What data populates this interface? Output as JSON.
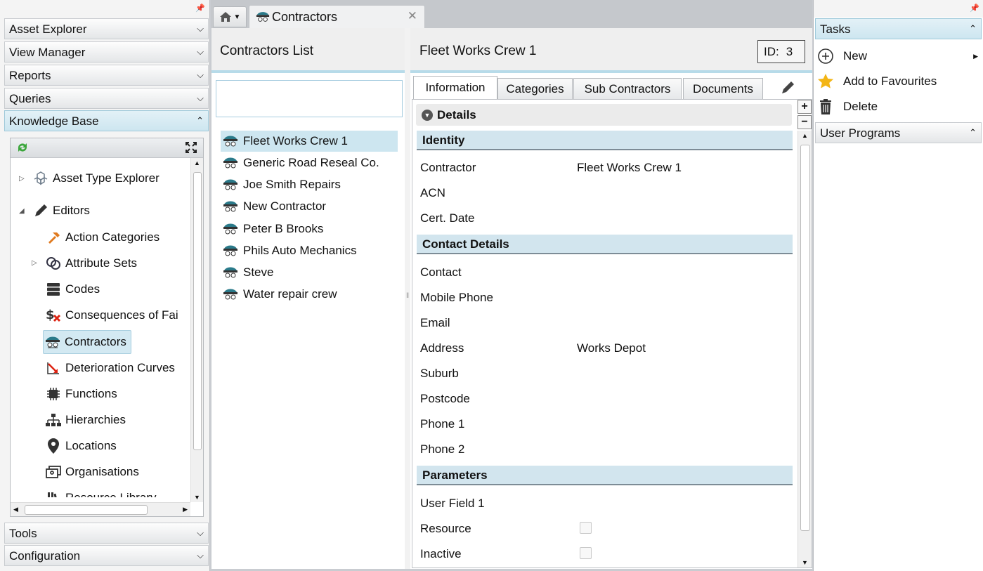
{
  "left_panel": {
    "sections_top": [
      {
        "label": "Asset Explorer",
        "expanded": false
      },
      {
        "label": "View Manager",
        "expanded": false
      },
      {
        "label": "Reports",
        "expanded": false
      },
      {
        "label": "Queries",
        "expanded": false
      },
      {
        "label": "Knowledge Base",
        "expanded": true
      }
    ],
    "tree": [
      {
        "label": "Asset Type Explorer",
        "icon": "cubes-icon",
        "level": 0,
        "expandable": true
      },
      {
        "label": "Editors",
        "icon": "pencil-icon",
        "level": 0,
        "expanded": true
      },
      {
        "label": "Action Categories",
        "icon": "hammer-icon",
        "level": 1
      },
      {
        "label": "Attribute Sets",
        "icon": "rings-icon",
        "level": 1,
        "expandable": true
      },
      {
        "label": "Codes",
        "icon": "database-icon",
        "level": 1
      },
      {
        "label": "Consequences of Fai",
        "icon": "dollar-cross-icon",
        "level": 1
      },
      {
        "label": "Contractors",
        "icon": "contractor-icon",
        "level": 1,
        "selected": true
      },
      {
        "label": "Deterioration Curves",
        "icon": "curve-icon",
        "level": 1
      },
      {
        "label": "Functions",
        "icon": "chip-icon",
        "level": 1
      },
      {
        "label": "Hierarchies",
        "icon": "hierarchy-icon",
        "level": 1
      },
      {
        "label": "Locations",
        "icon": "location-pin-icon",
        "level": 1
      },
      {
        "label": "Organisations",
        "icon": "organisation-icon",
        "level": 1
      },
      {
        "label": "Resource Library",
        "icon": "library-icon",
        "level": 1
      }
    ],
    "sections_bottom": [
      {
        "label": "Tools",
        "expanded": false
      },
      {
        "label": "Configuration",
        "expanded": false
      }
    ]
  },
  "tabs": {
    "home_label": "",
    "document_tab": "Contractors"
  },
  "list_panel": {
    "title": "Contractors List",
    "search_value": "",
    "items": [
      "Fleet Works Crew 1",
      "Generic Road Reseal Co.",
      "Joe Smith Repairs",
      "New Contractor",
      "Peter B Brooks",
      "Phils Auto Mechanics",
      "Steve",
      "Water repair crew"
    ],
    "selected_index": 0
  },
  "detail_panel": {
    "title": "Fleet Works Crew 1",
    "id_label": "ID:",
    "id_value": "3",
    "tabs": [
      "Information",
      "Categories",
      "Sub Contractors",
      "Documents"
    ],
    "active_tab": "Information",
    "details_label": "Details",
    "sections": {
      "identity": {
        "title": "Identity",
        "fields": [
          {
            "label": "Contractor",
            "value": "Fleet Works Crew 1"
          },
          {
            "label": "ACN",
            "value": ""
          },
          {
            "label": "Cert. Date",
            "value": ""
          }
        ]
      },
      "contact": {
        "title": "Contact Details",
        "fields": [
          {
            "label": "Contact",
            "value": ""
          },
          {
            "label": "Mobile Phone",
            "value": ""
          },
          {
            "label": "Email",
            "value": ""
          },
          {
            "label": "Address",
            "value": "Works Depot"
          },
          {
            "label": "Suburb",
            "value": ""
          },
          {
            "label": "Postcode",
            "value": ""
          },
          {
            "label": "Phone 1",
            "value": ""
          },
          {
            "label": "Phone 2",
            "value": ""
          }
        ]
      },
      "parameters": {
        "title": "Parameters",
        "fields": [
          {
            "label": "User Field 1",
            "value": ""
          },
          {
            "label": "Resource",
            "checked": false
          },
          {
            "label": "Inactive",
            "checked": false
          }
        ]
      }
    },
    "plus_symbol": "+",
    "minus_symbol": "−"
  },
  "right_panel": {
    "tasks_title": "Tasks",
    "tasks": [
      {
        "label": "New",
        "icon": "plus-circle-icon",
        "submenu": true
      },
      {
        "label": "Add to Favourites",
        "icon": "star-icon"
      },
      {
        "label": "Delete",
        "icon": "trash-icon"
      }
    ],
    "user_programs_title": "User Programs"
  },
  "colors": {
    "accent": "#b7dbe9",
    "selection": "#cde6f0",
    "section_header": "#d2e5ee"
  }
}
